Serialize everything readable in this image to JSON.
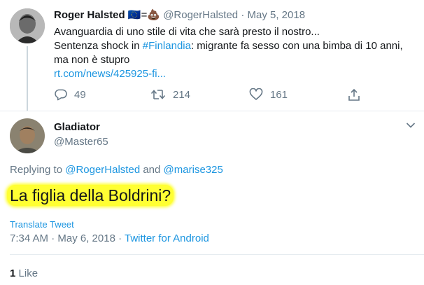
{
  "parent_tweet": {
    "name": "Roger Halsted",
    "emoji_flag": "🇪🇺",
    "emoji_equals": "=",
    "emoji_poo": "💩",
    "handle": "@RogerHalsted",
    "separator": "·",
    "date": "May 5, 2018",
    "line1": "Avanguardia di uno stile di vita che sarà presto il nostro...",
    "line2_prefix": "Sentenza shock in ",
    "hashtag": "#Finlandia",
    "line2_suffix": ": migrante fa sesso con una bimba di 10 anni,",
    "line3": "ma non è stupro",
    "link": "rt.com/news/425925-fi...",
    "replies": "49",
    "retweets": "214",
    "likes": "161"
  },
  "reply_tweet": {
    "name": "Gladiator",
    "handle": "@Master65",
    "replying_prefix": "Replying to ",
    "replying_user1": "@RogerHalsted",
    "replying_and": " and ",
    "replying_user2": "@marise325",
    "text": "La figlia della Boldrini?",
    "translate": "Translate Tweet",
    "time": "7:34 AM · May 6, 2018 · ",
    "source": "Twitter for Android",
    "likes_count": "1",
    "likes_label": "Like"
  },
  "colors": {
    "link": "#1b95e0",
    "muted": "#657786",
    "highlight": "#ffff33"
  }
}
